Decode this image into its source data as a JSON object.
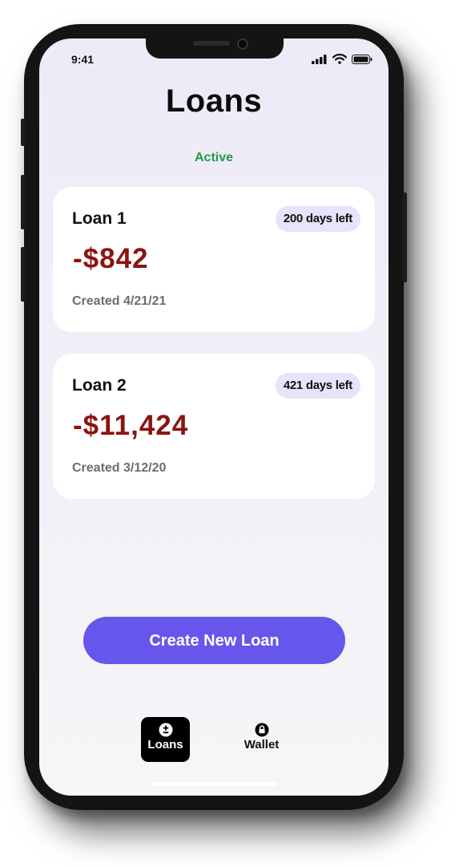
{
  "status_bar": {
    "time": "9:41"
  },
  "header": {
    "title": "Loans"
  },
  "section": {
    "label": "Active"
  },
  "loans": [
    {
      "name": "Loan 1",
      "days_left": "200 days left",
      "amount": "-$842",
      "created": "Created 4/21/21"
    },
    {
      "name": "Loan 2",
      "days_left": "421 days left",
      "amount": "-$11,424",
      "created": "Created 3/12/20"
    }
  ],
  "actions": {
    "create_label": "Create New Loan"
  },
  "tab_bar": {
    "items": [
      {
        "label": "Loans",
        "icon": "plus-minus-icon",
        "active": true
      },
      {
        "label": "Wallet",
        "icon": "lock-icon",
        "active": false
      }
    ]
  },
  "colors": {
    "accent": "#6656ec",
    "active_status": "#1f9a4a",
    "negative_amount": "#8b1410",
    "badge_background": "#e8e3fa"
  }
}
